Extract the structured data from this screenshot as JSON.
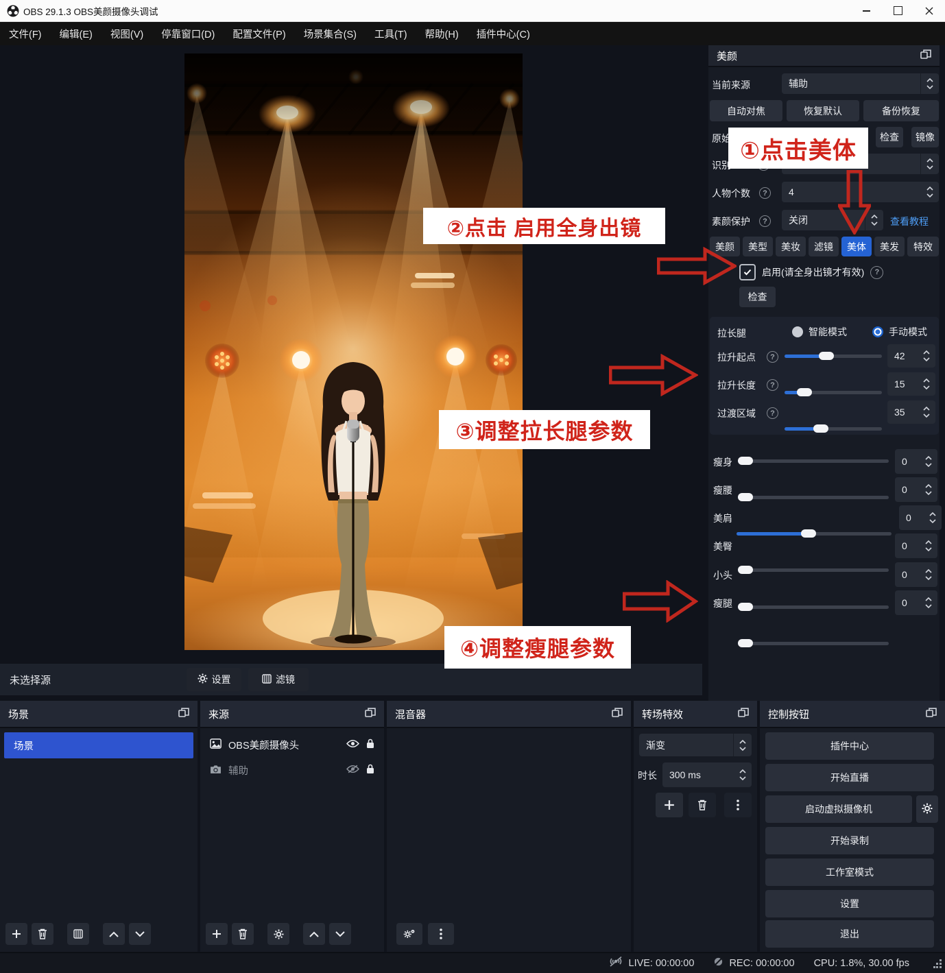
{
  "window": {
    "title": "OBS 29.1.3  OBS美颜摄像头调试"
  },
  "menu": {
    "items": [
      "文件(F)",
      "编辑(E)",
      "视图(V)",
      "停靠窗口(D)",
      "配置文件(P)",
      "场景集合(S)",
      "工具(T)",
      "帮助(H)",
      "插件中心(C)"
    ]
  },
  "beauty_panel": {
    "title": "美颜",
    "current_source": {
      "label": "当前来源",
      "value": "辅助"
    },
    "top_buttons": [
      "自动对焦",
      "恢复默认",
      "备份恢复"
    ],
    "original_row": {
      "label": "原始",
      "check": "检查",
      "mirror": "镜像"
    },
    "recognize_row": {
      "label": "识别"
    },
    "person_count": {
      "label": "人物个数",
      "value": "4"
    },
    "plain_face": {
      "label": "素颜保护",
      "value": "关闭",
      "link": "查看教程"
    },
    "tabs": [
      {
        "label": "美颜",
        "active": false
      },
      {
        "label": "美型",
        "active": false
      },
      {
        "label": "美妆",
        "active": false
      },
      {
        "label": "滤镜",
        "active": false
      },
      {
        "label": "美体",
        "active": true
      },
      {
        "label": "美发",
        "active": false
      },
      {
        "label": "特效",
        "active": false
      }
    ],
    "enable_row": {
      "label": "启用(请全身出镜才有效)"
    },
    "check_button": "检查",
    "leg_section": {
      "title": "拉长腿",
      "modes": [
        {
          "label": "智能模式",
          "selected": false
        },
        {
          "label": "手动模式",
          "selected": true
        }
      ],
      "sliders": [
        {
          "label": "拉升起点",
          "value": "42",
          "pos": 42
        },
        {
          "label": "拉升长度",
          "value": "15",
          "pos": 15
        },
        {
          "label": "过渡区域",
          "value": "35",
          "pos": 35
        }
      ]
    },
    "body_sliders": [
      {
        "label": "瘦身",
        "value": "0",
        "pos": 0
      },
      {
        "label": "瘦腰",
        "value": "0",
        "pos": 0
      },
      {
        "label": "美肩",
        "value": "0",
        "pos": 46
      },
      {
        "label": "美臀",
        "value": "0",
        "pos": 0
      },
      {
        "label": "小头",
        "value": "0",
        "pos": 0
      },
      {
        "label": "瘦腿",
        "value": "0",
        "pos": 0
      }
    ]
  },
  "callouts": {
    "step1": "①点击美体",
    "step2": "②点击 启用全身出镜",
    "step3": "③调整拉长腿参数",
    "step4": "④调整瘦腿参数"
  },
  "props_bar": {
    "label": "未选择源",
    "settings": "设置",
    "filters": "滤镜"
  },
  "docks": {
    "scenes": {
      "title": "场景",
      "items": [
        {
          "name": "场景",
          "selected": true
        }
      ]
    },
    "sources": {
      "title": "来源",
      "rows": [
        {
          "name": "OBS美颜摄像头",
          "visible": true
        },
        {
          "name": "辅助",
          "visible": false
        }
      ]
    },
    "mixer": {
      "title": "混音器"
    },
    "transitions": {
      "title": "转场特效",
      "transition": "渐变",
      "duration_label": "时长",
      "duration": "300 ms"
    },
    "controls": {
      "title": "控制按钮",
      "buttons": [
        "插件中心",
        "开始直播",
        "启动虚拟摄像机",
        "开始录制",
        "工作室模式",
        "设置",
        "退出"
      ]
    }
  },
  "statusbar": {
    "live": "LIVE: 00:00:00",
    "rec": "REC: 00:00:00",
    "cpu": "CPU: 1.8%, 30.00 fps"
  },
  "colors": {
    "accent_blue": "#2d6fd6",
    "selected_blue": "#2e54cf",
    "link_blue": "#4e9df5",
    "callout_red": "#d0241a"
  }
}
